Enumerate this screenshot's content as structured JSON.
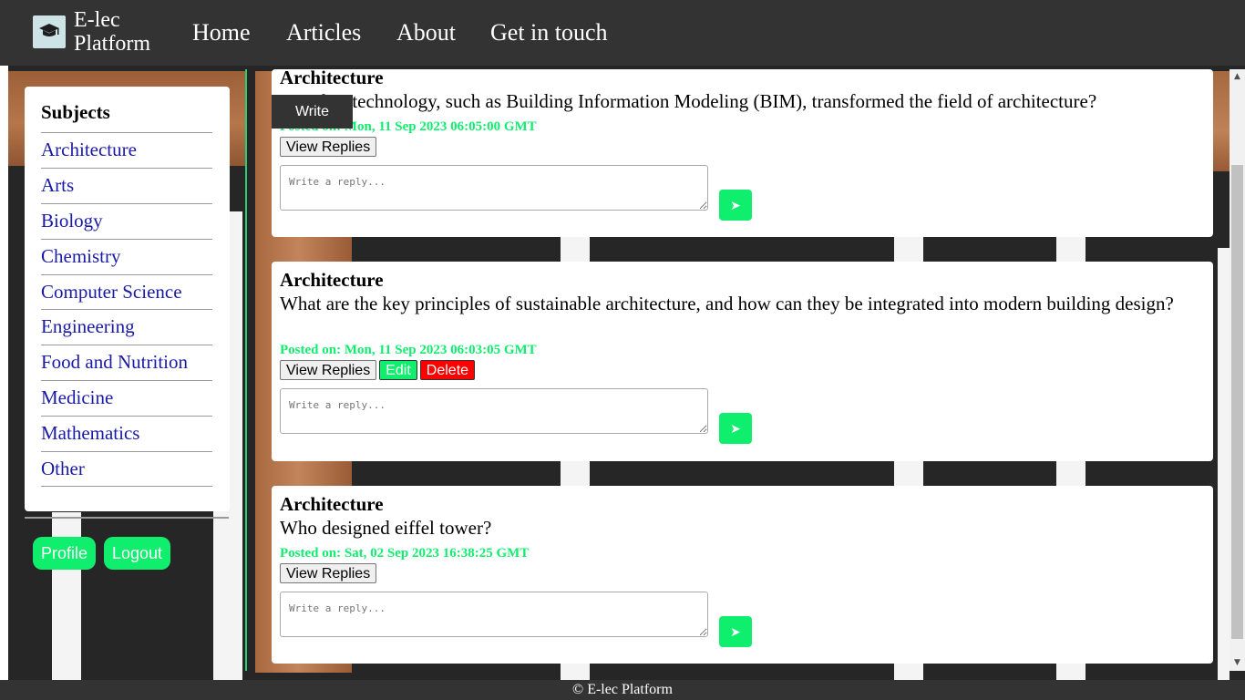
{
  "navbar": {
    "brand_line1": "E-lec",
    "brand_line2": "Platform",
    "links": [
      "Home",
      "Articles",
      "About",
      "Get in touch"
    ]
  },
  "sidebar": {
    "title": "Subjects",
    "items": [
      "Architecture",
      "Arts",
      "Biology",
      "Chemistry",
      "Computer Science",
      "Engineering",
      "Food and Nutrition",
      "Medicine",
      "Mathematics",
      "Other"
    ],
    "profile_label": "Profile",
    "logout_label": "Logout"
  },
  "write_label": "Write",
  "posts": [
    {
      "subject": "Architecture",
      "question": "How has technology, such as Building Information Modeling (BIM), transformed the field of architecture?",
      "date": "Posted on: Mon, 11 Sep 2023 06:05:00 GMT",
      "view_replies": "View Replies",
      "reply_placeholder": "Write a reply...",
      "send_icon": "send-icon"
    },
    {
      "subject": "Architecture",
      "question": "What are the key principles of sustainable architecture, and how can they be integrated into modern building design?",
      "date": "Posted on: Mon, 11 Sep 2023 06:03:05 GMT",
      "view_replies": "View Replies",
      "edit": "Edit",
      "delete": "Delete",
      "reply_placeholder": "Write a reply...",
      "send_icon": "send-icon"
    },
    {
      "subject": "Architecture",
      "question": "Who designed eiffel tower?",
      "date": "Posted on: Sat, 02 Sep 2023 16:38:25 GMT",
      "view_replies": "View Replies",
      "reply_placeholder": "Write a reply...",
      "send_icon": "send-icon"
    }
  ],
  "footer": "© E-lec Platform",
  "colors": {
    "accent": "#10ee6e",
    "navbar": "#333333",
    "link": "#1a1aa6",
    "danger": "#ff0000"
  }
}
